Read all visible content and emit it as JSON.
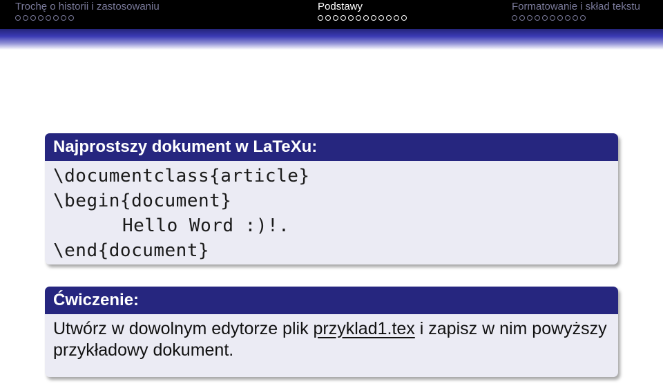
{
  "nav": {
    "sections": [
      {
        "label": "Trochę o historii i zastosowaniu",
        "dots": 8,
        "active": false
      },
      {
        "label": "Podstawy",
        "dots": 12,
        "active": true
      },
      {
        "label": "Formatowanie i skład tekstu",
        "dots": 10,
        "active": false
      }
    ]
  },
  "block1": {
    "title": "Najprostszy dokument w LaTeXu:",
    "lines": [
      "\\documentclass{article}",
      "\\begin{document}",
      "Hello Word :)!.",
      "\\end{document}"
    ]
  },
  "block2": {
    "title": "Ćwiczenie:",
    "text_before": "Utwórz w dowolnym edytorze plik ",
    "filename": "przyklad1.tex",
    "text_after": " i zapisz w nim powyższy przykładowy dokument."
  },
  "colors": {
    "header_bg": "#000000",
    "block_title_bg": "#26267f",
    "block_body_bg": "#ebebf4",
    "inactive_nav": "#7a7a9a"
  }
}
